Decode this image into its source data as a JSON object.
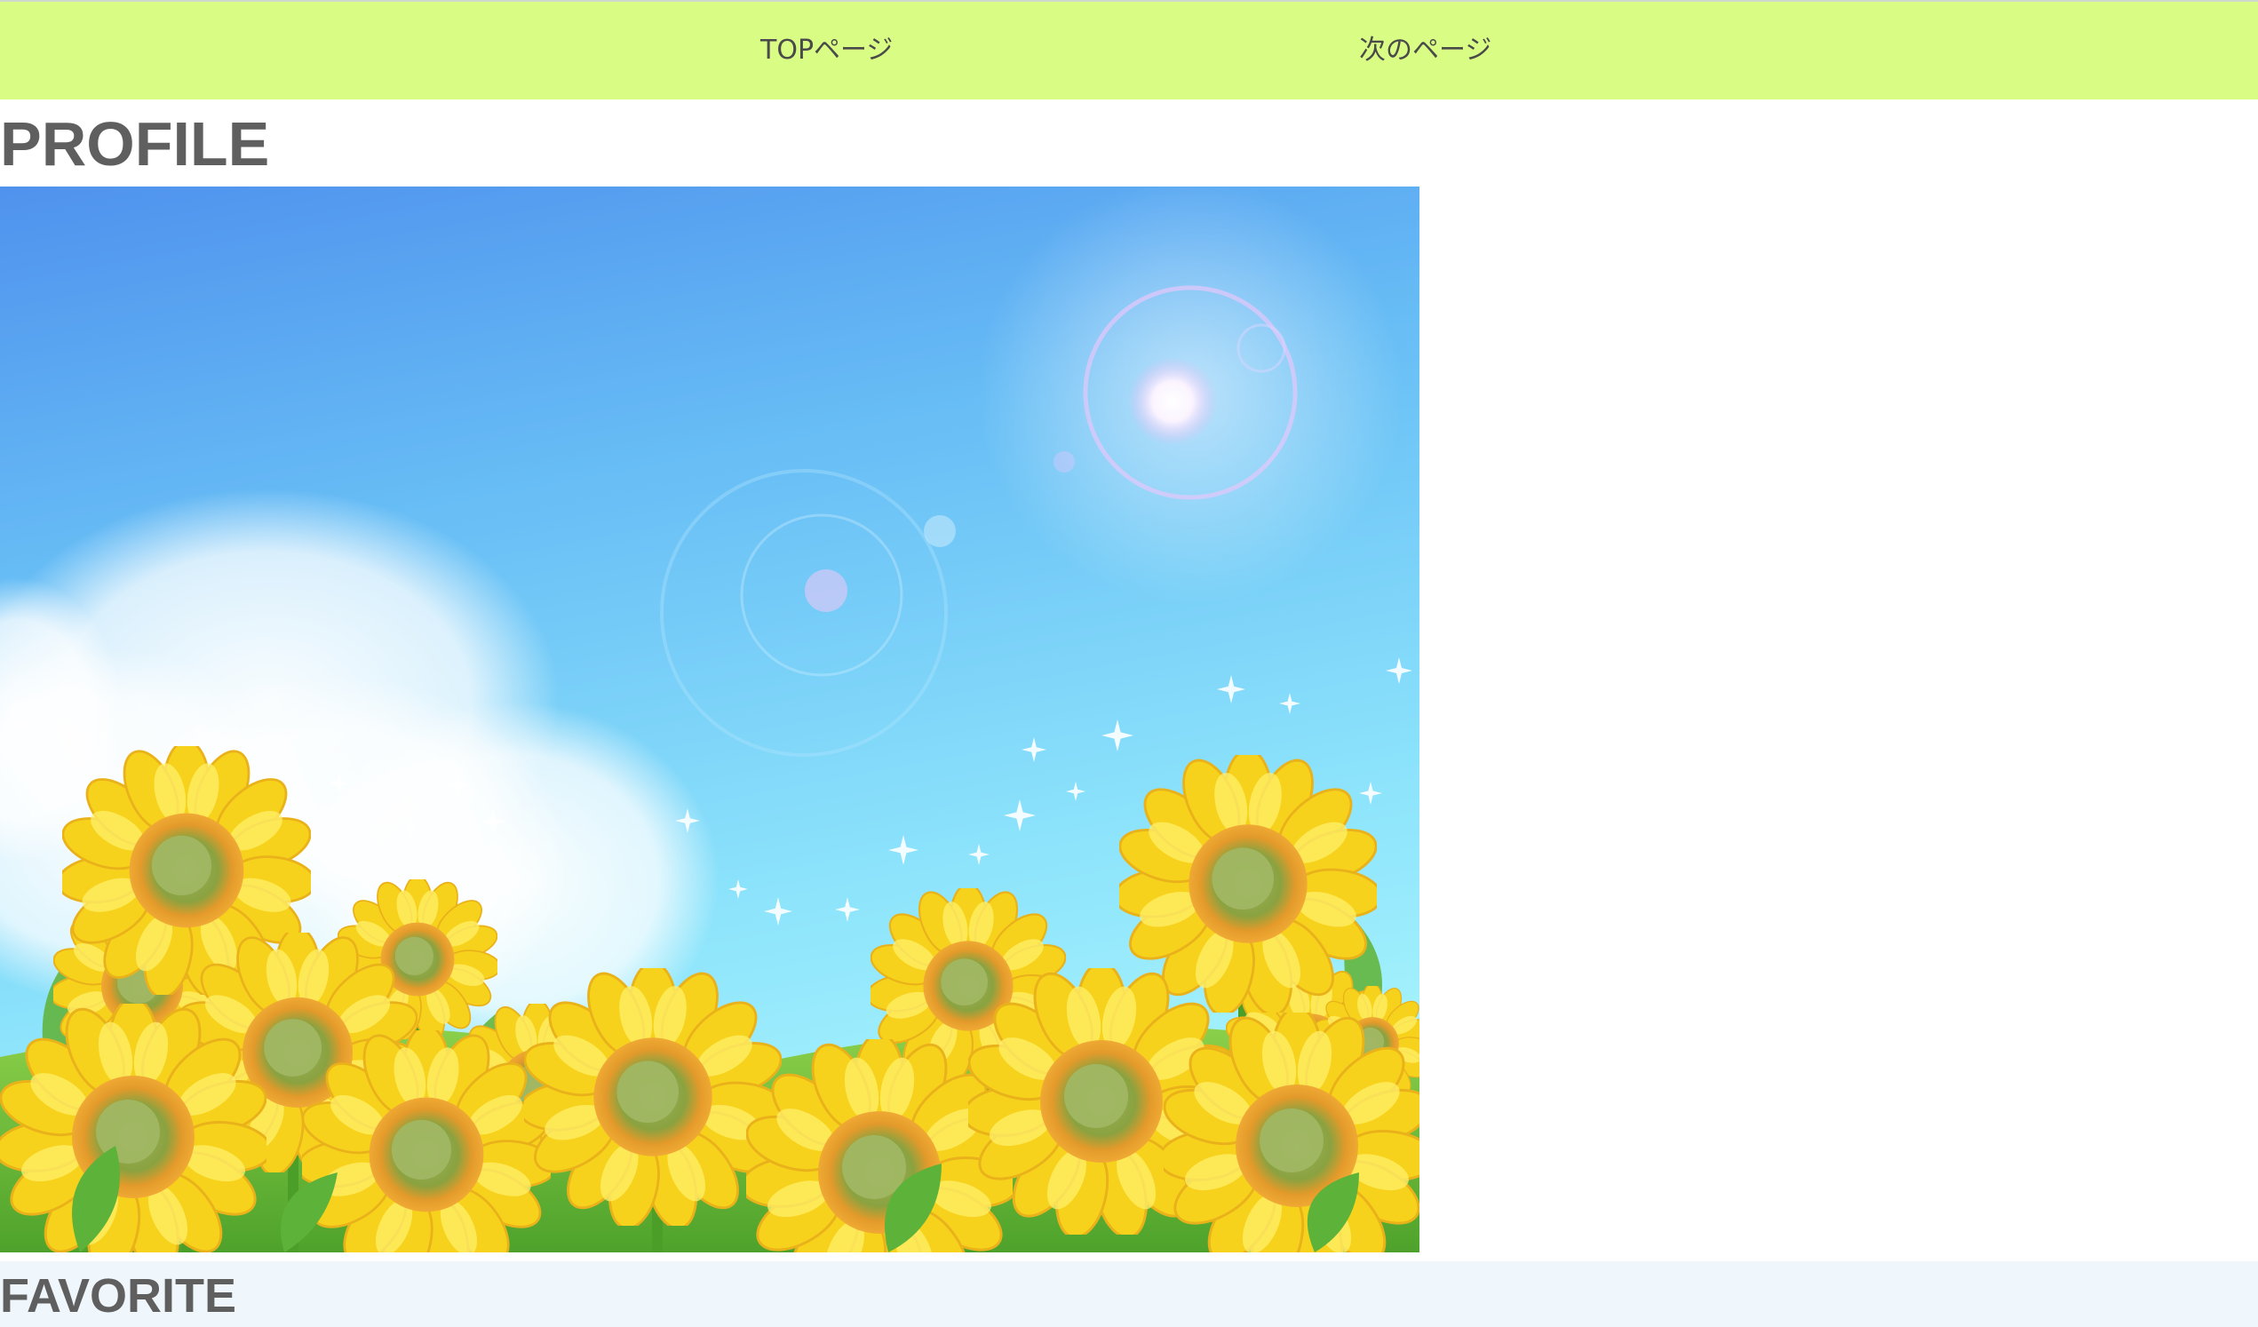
{
  "nav": {
    "items": [
      {
        "label": "TOPページ"
      },
      {
        "label": "次のページ"
      }
    ]
  },
  "profile": {
    "title": "PROFILE",
    "image": "sunflower-field-illustration"
  },
  "favorite": {
    "title": "FAVORITE"
  },
  "colors": {
    "nav_background": "#d9fd84",
    "heading_text": "#5f5f5f",
    "favorite_background": "#eff7fd"
  }
}
